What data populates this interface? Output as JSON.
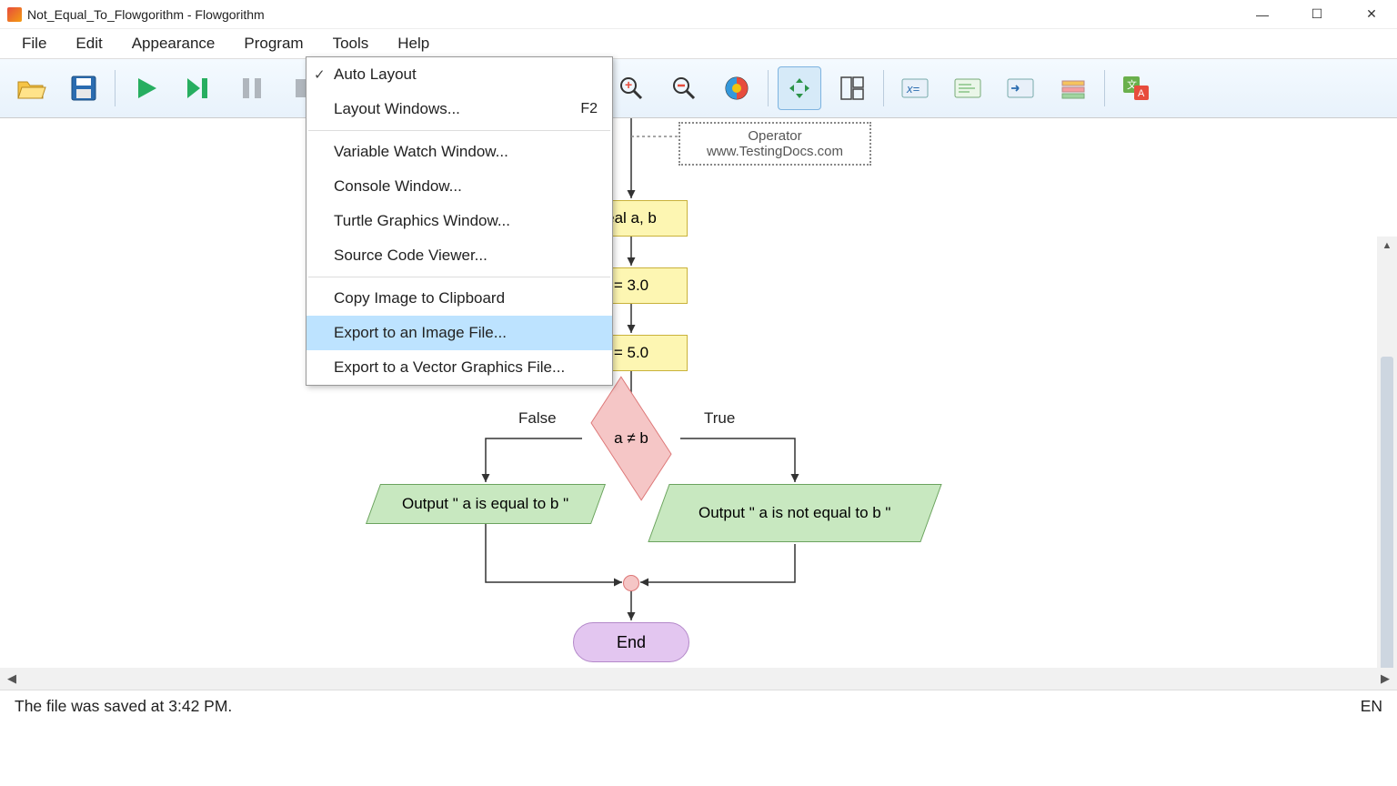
{
  "title": "Not_Equal_To_Flowgorithm - Flowgorithm",
  "menus": {
    "file": "File",
    "edit": "Edit",
    "appearance": "Appearance",
    "program": "Program",
    "tools": "Tools",
    "help": "Help"
  },
  "dropdown": {
    "auto_layout": "Auto Layout",
    "layout_windows": "Layout Windows...",
    "layout_windows_sc": "F2",
    "var_watch": "Variable Watch Window...",
    "console": "Console Window...",
    "turtle": "Turtle Graphics Window...",
    "src_viewer": "Source Code Viewer...",
    "copy_clip": "Copy Image to Clipboard",
    "export_img": "Export to an Image File...",
    "export_vec": "Export to a Vector Graphics File..."
  },
  "flow": {
    "comment_line1": "Operator",
    "comment_line2": "www.TestingDocs.com",
    "decl": "eal a, b",
    "assign1": "= 3.0",
    "assign2": "= 5.0",
    "cond": "a ≠ b",
    "false": "False",
    "true": "True",
    "out_false": "Output \" a is equal to b \"",
    "out_true": "Output \" a is not equal to b \"",
    "end": "End"
  },
  "status": {
    "msg": "The file was saved at 3:42 PM.",
    "lang": "EN"
  },
  "toolbar_icons": {
    "open": "open-icon",
    "save": "save-icon",
    "run": "play-icon",
    "step": "step-icon",
    "pause": "pause-icon",
    "stop": "stop-icon",
    "zoom_in": "zoom-in-icon",
    "zoom_out": "zoom-out-icon",
    "colors": "color-wheel-icon",
    "fit": "fit-icon",
    "layout": "layout-icon",
    "variables": "variable-icon",
    "code": "code-icon",
    "console": "console-icon",
    "functions": "functions-icon",
    "translate": "translate-icon"
  }
}
